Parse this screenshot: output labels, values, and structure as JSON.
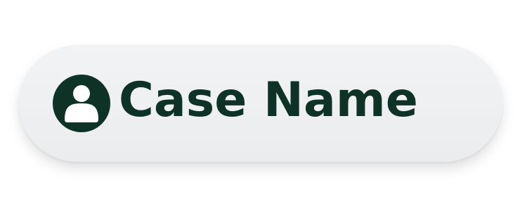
{
  "button": {
    "label": "Case Name",
    "icon": "user-avatar-icon"
  },
  "colors": {
    "text": "#0e3326",
    "icon": "#0e3326",
    "pill_background": "#eeeff0",
    "page_background": "#ffffff"
  }
}
